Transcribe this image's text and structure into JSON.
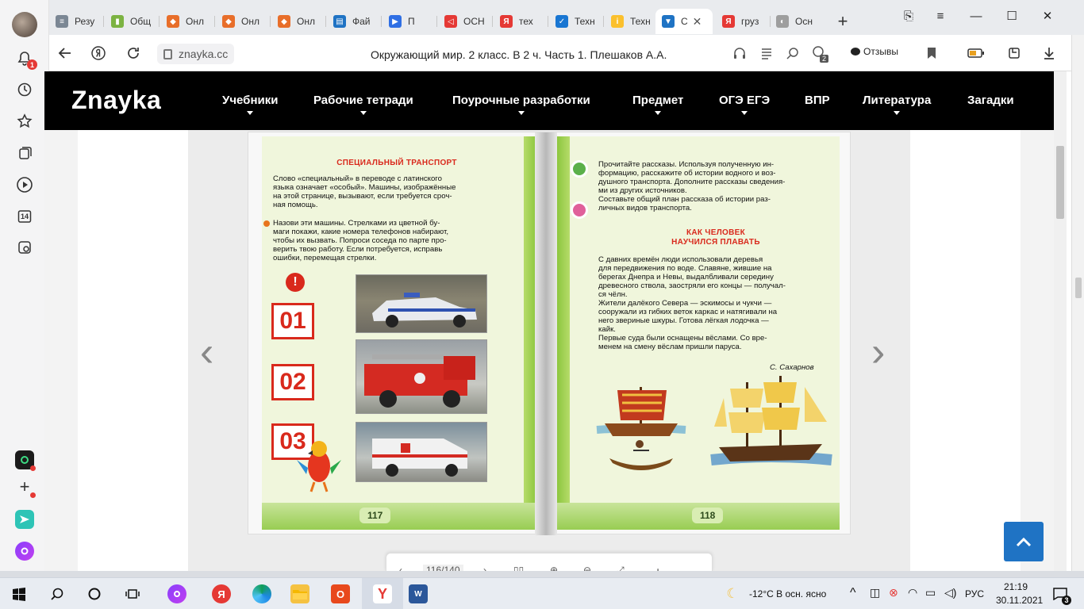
{
  "browser": {
    "tabs": [
      {
        "label": "Резу",
        "color": "#7b8794",
        "glyph": "≡"
      },
      {
        "label": "Общ",
        "color": "#7cb342",
        "glyph": "▮"
      },
      {
        "label": "Онл",
        "color": "#e86e2a",
        "glyph": "◆"
      },
      {
        "label": "Онл",
        "color": "#e86e2a",
        "glyph": "◆"
      },
      {
        "label": "Онл",
        "color": "#e86e2a",
        "glyph": "◆"
      },
      {
        "label": "Фай",
        "color": "#1f73c4",
        "glyph": "▤"
      },
      {
        "label": "П",
        "color": "#2f6fe4",
        "glyph": "▶"
      },
      {
        "label": "ОСН",
        "color": "#e53935",
        "glyph": "◁"
      },
      {
        "label": "тех",
        "color": "#e53935",
        "glyph": "Я"
      },
      {
        "label": "Техн",
        "color": "#1976d2",
        "glyph": "✓"
      },
      {
        "label": "Техн",
        "color": "#fbc02d",
        "glyph": "i"
      },
      {
        "label": "С",
        "color": "#1f73c4",
        "glyph": "▼",
        "active": true
      },
      {
        "label": "груз",
        "color": "#e53935",
        "glyph": "Я"
      },
      {
        "label": "Осн",
        "color": "#9e9e9e",
        "glyph": "◐"
      }
    ],
    "url": "znayka.cc",
    "page_title": "Окружающий мир. 2 класс. В 2 ч. Часть 1. Плешаков А.А.",
    "reviews_label": "Отзывы",
    "notification_count": "1",
    "sidebar_number": "14",
    "tab_count_badge": "2"
  },
  "site": {
    "logo": "Znayka",
    "menu": [
      "Учебники",
      "Рабочие тетради",
      "Поурочные разработки",
      "Предмет",
      "ОГЭ ЕГЭ",
      "ВПР",
      "Литература",
      "Загадки"
    ],
    "menu_with_caret": [
      true,
      true,
      true,
      true,
      true,
      false,
      true,
      false
    ]
  },
  "book": {
    "left_page": {
      "title": "СПЕЦИАЛЬНЫЙ ТРАНСПОРТ",
      "intro": "Слово «специальный» в переводе с латинского\nязыка означает «особый». Машины, изображённые\nна этой странице, вызывают, если требуется сроч-\nная помощь.",
      "task": "Назови эти машины. Стрелками из цветной бу-\nмаги покажи, какие номера телефонов набирают,\nчтобы их вызвать. Попроси соседа по парте про-\nверить твою работу. Если потребуется, исправь\nошибки, перемещая стрелки.",
      "numbers": [
        "01",
        "02",
        "03"
      ],
      "page_number": "117"
    },
    "right_page": {
      "instructions": "Прочитайте рассказы. Используя полученную ин-\nформацию, расскажите об истории водного и воз-\nдушного транспорта. Дополните рассказы сведения-\nми из других источников.\n   Составьте общий план рассказа об истории раз-\nличных видов транспорта.",
      "story_title_1": "КАК ЧЕЛОВЕК",
      "story_title_2": "НАУЧИЛСЯ ПЛАВАТЬ",
      "story": "С давних времён люди использовали деревья\nдля передвижения по воде. Славяне, жившие на\nберегах Днепра и Невы, выдалбливали середину\nдревесного ствола, заостряли его концы — получал-\nся чёлн.\n   Жители далёкого Севера — эскимосы и чукчи —\nсооружали из гибких веток каркас и натягивали на\nнего звериные шкуры. Готова лёгкая лодочка —\nкайк.\n   Первые суда были оснащены вёслами. Со вре-\nменем на смену вёслам пришли паруса.",
      "author": "С. Сахарнов",
      "page_number": "118"
    }
  },
  "viewer": {
    "page_indicator": "116/140"
  },
  "taskbar": {
    "weather": "-12°C  В осн. ясно",
    "language": "РУС",
    "time": "21:19",
    "date": "30.11.2021",
    "notification_count": "3"
  },
  "colors": {
    "accent": "#1f73c4",
    "site_header": "#000000",
    "book_red": "#d9291c",
    "book_green": "#8cc63f"
  }
}
